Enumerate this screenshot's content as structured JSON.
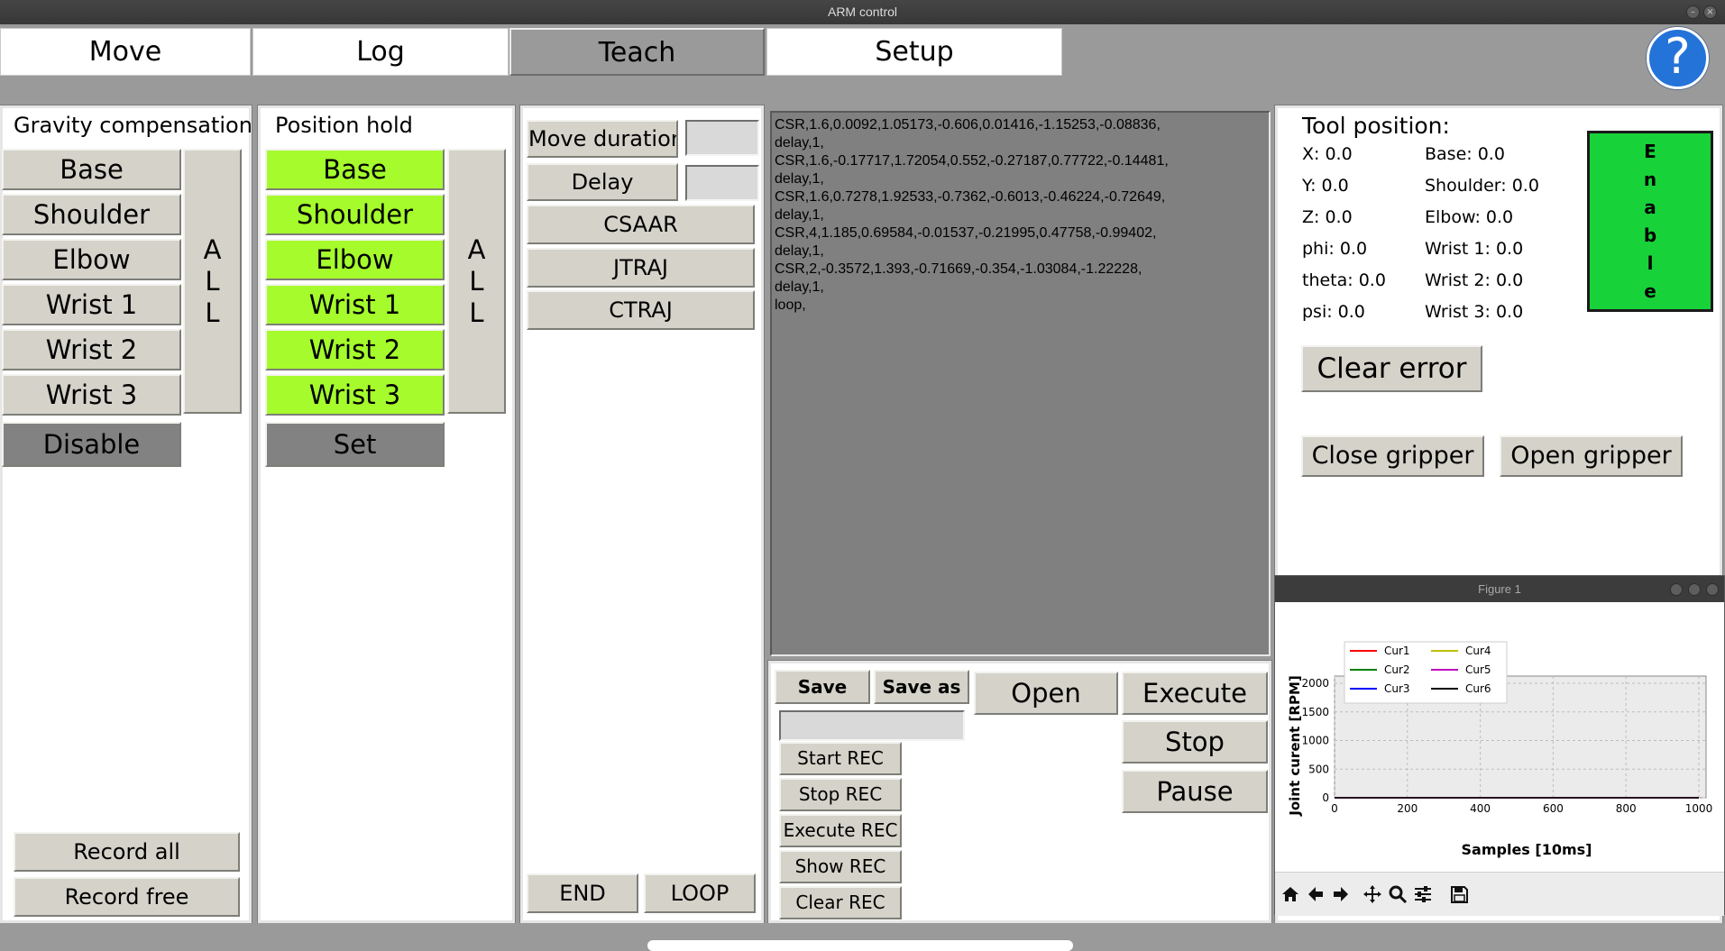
{
  "window": {
    "title": "ARM control"
  },
  "tabs": [
    {
      "label": "Move"
    },
    {
      "label": "Log"
    },
    {
      "label": "Teach"
    },
    {
      "label": "Setup"
    }
  ],
  "help": {
    "label": "?"
  },
  "gravity": {
    "title": "Gravity compensation",
    "joints": [
      "Base",
      "Shoulder",
      "Elbow",
      "Wrist 1",
      "Wrist 2",
      "Wrist 3"
    ],
    "all": [
      "A",
      "L",
      "L"
    ],
    "disable": "Disable",
    "record_all": "Record all",
    "record_free": "Record free"
  },
  "hold": {
    "title": "Position hold",
    "joints": [
      "Base",
      "Shoulder",
      "Elbow",
      "Wrist 1",
      "Wrist 2",
      "Wrist 3"
    ],
    "all": [
      "A",
      "L",
      "L"
    ],
    "set": "Set"
  },
  "teach": {
    "move_duration": "Move duration",
    "move_duration_value": "",
    "delay": "Delay",
    "delay_value": "",
    "csaar": "CSAAR",
    "jtraj": "JTRAJ",
    "ctraj": "CTRAJ",
    "end": "END",
    "loop": "LOOP"
  },
  "script": {
    "text": "CSR,1.6,0.0092,1.05173,-0.606,0.01416,-1.15253,-0.08836,\ndelay,1,\nCSR,1.6,-0.17717,1.72054,0.552,-0.27187,0.77722,-0.14481,\ndelay,1,\nCSR,1.6,0.7278,1.92533,-0.7362,-0.6013,-0.46224,-0.72649,\ndelay,1,\nCSR,4,1.185,0.69584,-0.01537,-0.21995,0.47758,-0.99402,\ndelay,1,\nCSR,2,-0.3572,1.393,-0.71669,-0.354,-1.03084,-1.22228,\ndelay,1,\nloop,"
  },
  "file": {
    "save": "Save",
    "save_as": "Save as",
    "filename": "",
    "open": "Open",
    "execute": "Execute",
    "stop": "Stop",
    "pause": "Pause",
    "start_rec": "Start REC",
    "stop_rec": "Stop REC",
    "execute_rec": "Execute REC",
    "show_rec": "Show REC",
    "clear_rec": "Clear REC"
  },
  "tool": {
    "title": "Tool position:",
    "x": "X: 0.0",
    "y": "Y: 0.0",
    "z": "Z: 0.0",
    "phi": "phi: 0.0",
    "theta": "theta: 0.0",
    "psi": "psi: 0.0",
    "base": "Base: 0.0",
    "shoulder": "Shoulder: 0.0",
    "elbow": "Elbow: 0.0",
    "wrist1": "Wrist 1: 0.0",
    "wrist2": "Wrist 2: 0.0",
    "wrist3": "Wrist 3: 0.0",
    "enable": [
      "E",
      "n",
      "a",
      "b",
      "l",
      "e"
    ],
    "enable_color": "#18d23a",
    "clear_error": "Clear error",
    "close_gripper": "Close gripper",
    "open_gripper": "Open gripper"
  },
  "figure": {
    "title": "Figure 1",
    "toolbar_icons": [
      "home-icon",
      "back-arrow-icon",
      "forward-arrow-icon",
      "pan-icon",
      "zoom-icon",
      "configure-icon",
      "save-icon"
    ]
  },
  "chart_data": {
    "type": "line",
    "title": "",
    "xlabel": "Samples [10ms]",
    "ylabel": "Joint curent [RPM]",
    "xlim": [
      0,
      1000
    ],
    "ylim": [
      0,
      2000
    ],
    "xticks": [
      "0",
      "200",
      "400",
      "600",
      "800",
      "1000"
    ],
    "yticks": [
      "0",
      "500",
      "1000",
      "1500",
      "2000"
    ],
    "grid": true,
    "legend_position": "top-left",
    "series": [
      {
        "name": "Cur1",
        "color": "#ff0000",
        "x": [
          0,
          1000
        ],
        "y": [
          0,
          0
        ]
      },
      {
        "name": "Cur2",
        "color": "#008000",
        "x": [
          0,
          1000
        ],
        "y": [
          0,
          0
        ]
      },
      {
        "name": "Cur3",
        "color": "#0000ff",
        "x": [
          0,
          1000
        ],
        "y": [
          0,
          0
        ]
      },
      {
        "name": "Cur4",
        "color": "#bfbf00",
        "x": [
          0,
          1000
        ],
        "y": [
          0,
          0
        ]
      },
      {
        "name": "Cur5",
        "color": "#bf00bf",
        "x": [
          0,
          1000
        ],
        "y": [
          0,
          0
        ]
      },
      {
        "name": "Cur6",
        "color": "#000000",
        "x": [
          0,
          1000
        ],
        "y": [
          0,
          0
        ]
      }
    ]
  }
}
